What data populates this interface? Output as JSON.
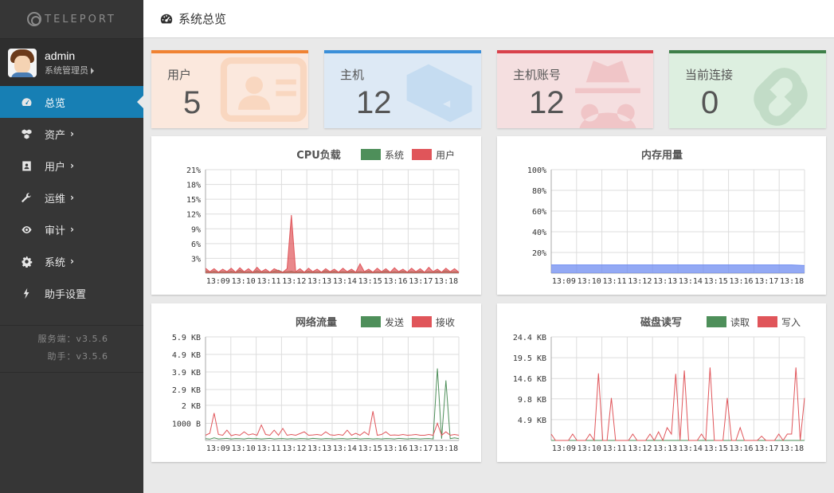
{
  "logo": {
    "text": "TELEPORT"
  },
  "user": {
    "name": "admin",
    "role": "系统管理员"
  },
  "nav": [
    {
      "label": "总览",
      "icon": "dashboard-icon",
      "active": true,
      "chevron": false
    },
    {
      "label": "资产",
      "icon": "cubes-icon",
      "active": false,
      "chevron": true
    },
    {
      "label": "用户",
      "icon": "user-card-icon",
      "active": false,
      "chevron": true
    },
    {
      "label": "运维",
      "icon": "wrench-icon",
      "active": false,
      "chevron": true
    },
    {
      "label": "审计",
      "icon": "eye-icon",
      "active": false,
      "chevron": true
    },
    {
      "label": "系统",
      "icon": "gear-icon",
      "active": false,
      "chevron": true
    },
    {
      "label": "助手设置",
      "icon": "bolt-icon",
      "active": false,
      "chevron": false
    }
  ],
  "versions": {
    "server": "服务端：v3.5.6",
    "assist": "助手：v3.5.6"
  },
  "header": {
    "title": "系统总览"
  },
  "cards": [
    {
      "label": "用户",
      "value": "5",
      "accent": "#f08232",
      "bg": "#fbe8dd",
      "icon": "id-card-icon"
    },
    {
      "label": "主机",
      "value": "12",
      "accent": "#3a8fd9",
      "bg": "#dde9f5",
      "icon": "cubes-icon"
    },
    {
      "label": "主机账号",
      "value": "12",
      "accent": "#d9414b",
      "bg": "#f5dfe0",
      "icon": "spy-icon"
    },
    {
      "label": "当前连接",
      "value": "0",
      "accent": "#3d7f48",
      "bg": "#ddefe0",
      "icon": "link-icon"
    }
  ],
  "colors": {
    "green": "#4e8f5a",
    "red": "#e0555a",
    "blue": "#6f8cf0"
  },
  "chart_data": [
    {
      "type": "area",
      "title": "CPU负载",
      "x_ticks": [
        "13:09",
        "13:10",
        "13:11",
        "13:12",
        "13:13",
        "13:14",
        "13:15",
        "13:16",
        "13:17",
        "13:18"
      ],
      "ylim": [
        0,
        21
      ],
      "y_ticks": [
        "3%",
        "6%",
        "9%",
        "12%",
        "15%",
        "18%",
        "21%"
      ],
      "y_tick_values": [
        3,
        6,
        9,
        12,
        15,
        18,
        21
      ],
      "series": [
        {
          "name": "系统",
          "color": "#4e8f5a",
          "values": [
            0.5,
            0.2,
            0.4,
            0.2,
            0.3,
            0.2,
            0.4,
            0.2,
            0.6,
            0.2,
            0.3,
            0.2,
            0.5,
            0.2,
            0.3,
            0.2,
            0.4,
            0.6,
            0.2,
            0.3,
            0.4,
            0.2,
            0.3,
            0.2,
            0.4,
            0.2,
            0.3,
            0.2,
            0.5,
            0.2,
            0.4,
            0.2,
            0.3,
            0.2,
            0.4,
            0.2,
            0.3,
            0.2,
            0.4,
            0.2,
            0.3,
            0.2,
            0.5,
            0.2,
            0.3,
            0.2,
            0.4,
            0.2,
            0.3,
            0.2,
            0.4,
            0.2,
            0.3,
            0.2,
            0.4,
            0.2,
            0.5,
            0.2,
            0.3,
            0.2
          ]
        },
        {
          "name": "用户",
          "color": "#e0555a",
          "values": [
            1,
            0.3,
            0.9,
            0.2,
            0.8,
            0.3,
            1,
            0.2,
            1.1,
            0.3,
            0.9,
            0.2,
            1.2,
            0.3,
            0.8,
            0.2,
            0.9,
            0.5,
            0.2,
            0.9,
            11.8,
            0.3,
            0.9,
            0.2,
            1,
            0.3,
            0.8,
            0.2,
            0.9,
            0.3,
            0.8,
            0.2,
            1,
            0.3,
            0.8,
            0.2,
            1.9,
            0.3,
            0.8,
            0.2,
            1,
            0.3,
            0.9,
            0.2,
            1.1,
            0.3,
            0.8,
            0.2,
            1,
            0.3,
            0.9,
            0.2,
            1.2,
            0.3,
            0.8,
            0.2,
            1,
            0.3,
            0.9,
            0.2
          ]
        }
      ]
    },
    {
      "type": "area",
      "title": "内存用量",
      "x_ticks": [
        "13:09",
        "13:10",
        "13:11",
        "13:12",
        "13:13",
        "13:14",
        "13:15",
        "13:16",
        "13:17",
        "13:18"
      ],
      "ylim": [
        0,
        100
      ],
      "y_ticks": [
        "20%",
        "40%",
        "60%",
        "80%",
        "100%"
      ],
      "y_tick_values": [
        20,
        40,
        60,
        80,
        100
      ],
      "series": [
        {
          "color": "#6f8cf0",
          "values": [
            8,
            8,
            8,
            8,
            8,
            8,
            8,
            8,
            8,
            8,
            8,
            8,
            8,
            8,
            8,
            8,
            8,
            8,
            8,
            8,
            8,
            8,
            8,
            8,
            8,
            8,
            8,
            8,
            8,
            8,
            8,
            8,
            8,
            8,
            8,
            8,
            8,
            8,
            8,
            8,
            8,
            8,
            8,
            8,
            8,
            8,
            8,
            8,
            8,
            8,
            8,
            8,
            8,
            8,
            8,
            8,
            8,
            7.8,
            7.6,
            7.4
          ]
        }
      ]
    },
    {
      "type": "line",
      "title": "网络流量",
      "x_ticks": [
        "13:09",
        "13:10",
        "13:11",
        "13:12",
        "13:13",
        "13:14",
        "13:15",
        "13:16",
        "13:17",
        "13:18"
      ],
      "ylim": [
        0,
        6040
      ],
      "y_ticks": [
        "1000 B",
        "2 KB",
        "2.9 KB",
        "3.9 KB",
        "4.9 KB",
        "5.9 KB"
      ],
      "y_tick_values": [
        1000,
        2048,
        2970,
        3994,
        5018,
        6042
      ],
      "series": [
        {
          "name": "发送",
          "color": "#4e8f5a",
          "values": [
            100,
            80,
            150,
            90,
            100,
            120,
            90,
            110,
            100,
            90,
            130,
            100,
            110,
            90,
            100,
            120,
            90,
            100,
            110,
            90,
            100,
            90,
            110,
            100,
            90,
            120,
            100,
            90,
            110,
            100,
            90,
            100,
            110,
            90,
            100,
            120,
            90,
            100,
            110,
            90,
            100,
            90,
            110,
            100,
            90,
            120,
            100,
            90,
            110,
            100,
            90,
            100,
            110,
            90,
            4200,
            100,
            3500,
            100,
            150,
            100
          ]
        },
        {
          "name": "接收",
          "color": "#e0555a",
          "values": [
            300,
            420,
            1600,
            350,
            300,
            600,
            280,
            350,
            300,
            500,
            320,
            380,
            300,
            900,
            350,
            300,
            600,
            300,
            700,
            300,
            350,
            300,
            400,
            500,
            300,
            320,
            350,
            300,
            500,
            330,
            300,
            350,
            300,
            600,
            300,
            420,
            300,
            500,
            320,
            1700,
            300,
            350,
            500,
            300,
            320,
            300,
            350,
            300,
            320,
            350,
            300,
            300,
            350,
            300,
            1000,
            300,
            500,
            300,
            350,
            300
          ]
        }
      ]
    },
    {
      "type": "line",
      "title": "磁盘读写",
      "x_ticks": [
        "13:09",
        "13:10",
        "13:11",
        "13:12",
        "13:13",
        "13:14",
        "13:15",
        "13:16",
        "13:17",
        "13:18"
      ],
      "ylim": [
        0,
        24.4
      ],
      "y_ticks": [
        "4.9 KB",
        "9.8 KB",
        "14.6 KB",
        "19.5 KB",
        "24.4 KB"
      ],
      "y_tick_values": [
        4.9,
        9.8,
        14.6,
        19.5,
        24.4
      ],
      "series": [
        {
          "name": "读取",
          "color": "#4e8f5a",
          "values": [
            0,
            0,
            0,
            0,
            0,
            0,
            0,
            0,
            0,
            0,
            0,
            0,
            0,
            0,
            0,
            0,
            0,
            0,
            0,
            0,
            0,
            0,
            0,
            0,
            0,
            0,
            0,
            0,
            0,
            0,
            0,
            0,
            0,
            0,
            0,
            0,
            0,
            0,
            0,
            0,
            0,
            0,
            0,
            0,
            0,
            0,
            0,
            0,
            0,
            0,
            0,
            0,
            0,
            0,
            0,
            0,
            0,
            0,
            0,
            0
          ]
        },
        {
          "name": "写入",
          "color": "#e0555a",
          "values": [
            1.5,
            0,
            0,
            0,
            0,
            1.5,
            0,
            0,
            0,
            1.5,
            0,
            15.8,
            0,
            0,
            10,
            0,
            0,
            0,
            0,
            1.5,
            0,
            0,
            0,
            1.5,
            0,
            2,
            0,
            3,
            1.5,
            15.7,
            0,
            16.5,
            0,
            0,
            0,
            1.5,
            0,
            17.2,
            0,
            0,
            0,
            10,
            0,
            0,
            3,
            0,
            0,
            0,
            0,
            1,
            0,
            0,
            0,
            1.5,
            0,
            1.5,
            1.5,
            17.2,
            0,
            10
          ]
        }
      ]
    }
  ]
}
